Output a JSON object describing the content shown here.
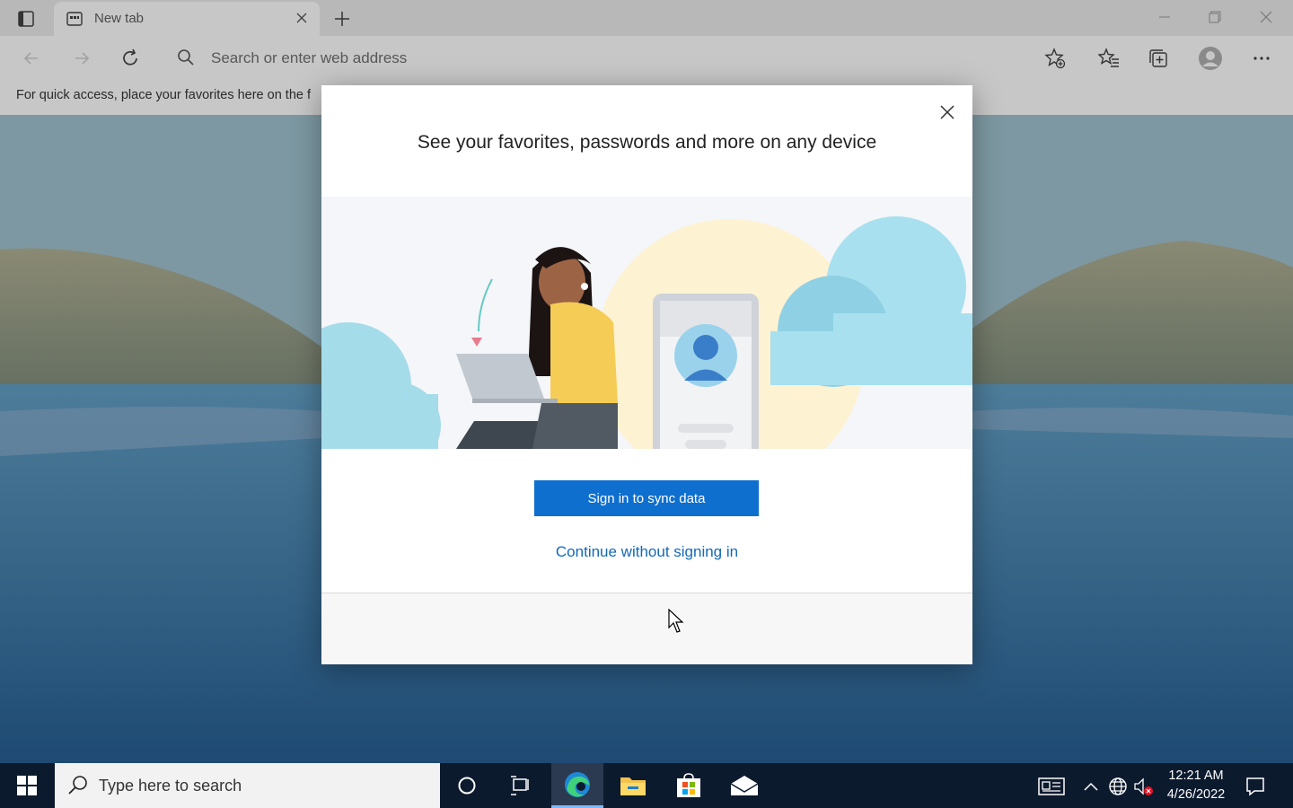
{
  "browser": {
    "tab_title": "New tab",
    "address_placeholder": "Search or enter web address",
    "favorites_hint": "For quick access, place your favorites here on the f",
    "icons": {
      "tab_actions": "tab-actions-icon",
      "favicon": "new-tab-page-icon",
      "close_tab": "close-icon",
      "new_tab": "plus-icon",
      "minimize": "minimize-icon",
      "restore": "restore-icon",
      "close_window": "close-icon",
      "back": "back-arrow-icon",
      "forward": "forward-arrow-icon",
      "refresh": "refresh-icon",
      "search": "search-icon",
      "add_favorite": "star-add-icon",
      "favorites": "favorites-icon",
      "collections": "collections-icon",
      "profile": "profile-avatar-icon",
      "more": "more-icon"
    }
  },
  "dialog": {
    "title": "See your favorites, passwords and more on any device",
    "primary_button": "Sign in to sync data",
    "secondary_link": "Continue without signing in",
    "close_icon": "close-icon",
    "colors": {
      "primary": "#0e6fce",
      "link": "#1469b8"
    }
  },
  "taskbar": {
    "search_placeholder": "Type here to search",
    "time": "12:21 AM",
    "date": "4/26/2022",
    "apps": [
      "cortana-icon",
      "task-view-icon",
      "edge-icon",
      "file-explorer-icon",
      "store-icon",
      "mail-icon"
    ],
    "tray": [
      "news-icon",
      "chevron-up-icon",
      "network-icon",
      "volume-muted-icon",
      "notification-icon"
    ]
  }
}
